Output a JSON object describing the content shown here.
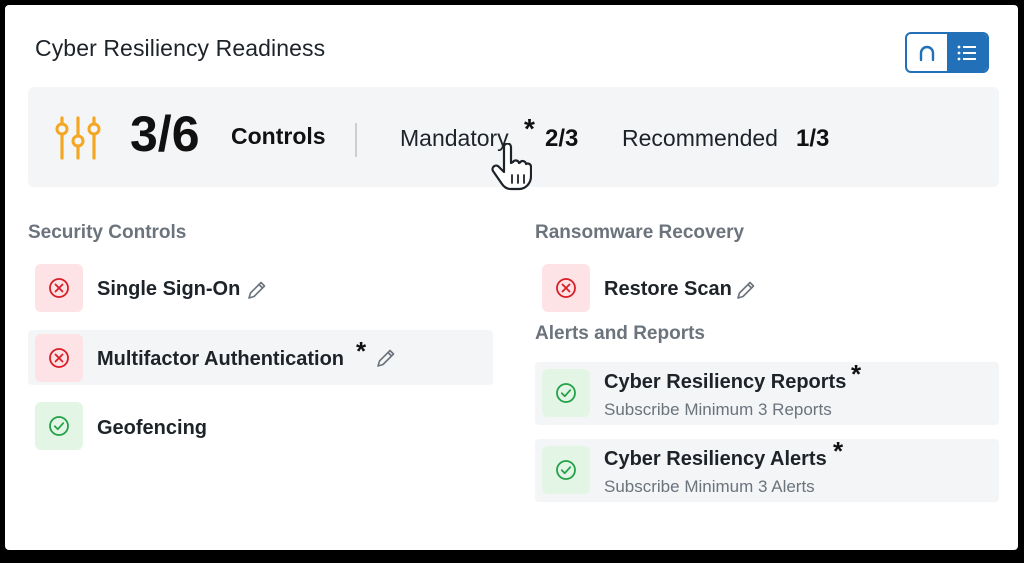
{
  "header": {
    "title": "Cyber Resiliency Readiness",
    "view_toggle": {
      "icons": [
        "arc-view-icon",
        "list-view-icon"
      ],
      "selected": "list"
    }
  },
  "summary": {
    "count": "3/6",
    "controls_label": "Controls",
    "mandatory_label": "Mandatory",
    "mandatory_star": "*",
    "mandatory_value": "2/3",
    "recommended_label": "Recommended",
    "recommended_value": "1/3",
    "accent_color": "#f5a623"
  },
  "sections": {
    "security": {
      "title": "Security Controls",
      "items": [
        {
          "label": "Single Sign-On",
          "status": "fail",
          "editable": true
        },
        {
          "label": "Multifactor Authentication",
          "status": "fail",
          "mandatory": "*",
          "editable": true
        },
        {
          "label": "Geofencing",
          "status": "ok"
        }
      ]
    },
    "ransomware": {
      "title": "Ransomware Recovery",
      "items": [
        {
          "label": "Restore Scan",
          "status": "fail",
          "editable": true
        }
      ]
    },
    "alerts": {
      "title": "Alerts and Reports",
      "items": [
        {
          "label": "Cyber Resiliency Reports",
          "status": "ok",
          "mandatory": "*",
          "sub": "Subscribe Minimum 3 Reports"
        },
        {
          "label": "Cyber Resiliency Alerts",
          "status": "ok",
          "mandatory": "*",
          "sub": "Subscribe Minimum 3 Alerts"
        }
      ]
    }
  },
  "colors": {
    "fail": "#da1e28",
    "ok": "#24a148",
    "primary": "#2170b8"
  }
}
